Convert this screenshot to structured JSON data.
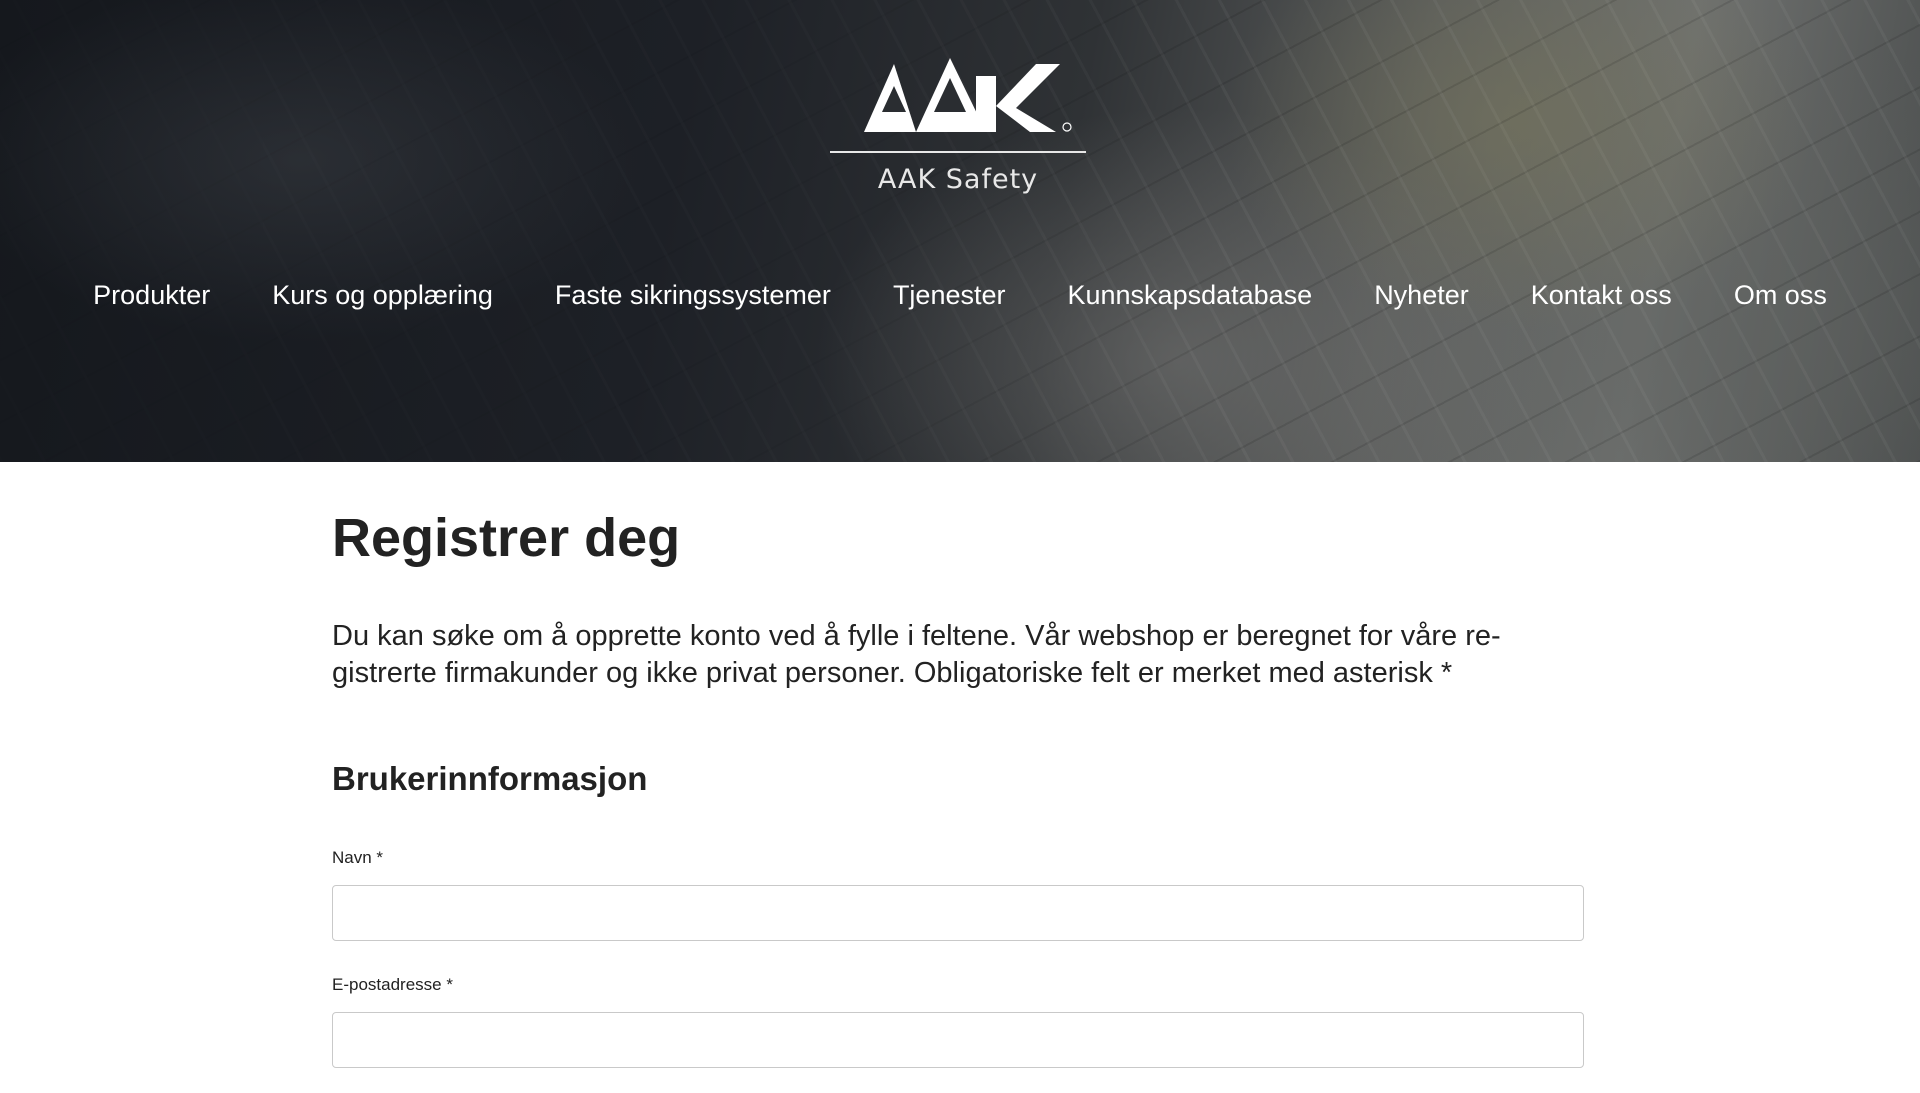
{
  "header": {
    "logo_text": "AAK",
    "brand": "AAK Safety",
    "nav": [
      {
        "label": "Produkter"
      },
      {
        "label": "Kurs og opplæring"
      },
      {
        "label": "Faste sikringssystemer"
      },
      {
        "label": "Tjenester"
      },
      {
        "label": "Kunnskapsdatabase"
      },
      {
        "label": "Nyheter"
      },
      {
        "label": "Kontakt oss"
      },
      {
        "label": "Om oss"
      }
    ]
  },
  "main": {
    "title": "Registrer deg",
    "intro": "Du kan søke om å opprette konto ved å fylle i feltene. Vår webshop er beregnet for våre re­gistrerte firmakunder og ikke privat personer. Obligatoriske felt er merket med asterisk *",
    "section_title": "Brukerinnformasjon",
    "fields": [
      {
        "label": "Navn *",
        "value": ""
      },
      {
        "label": "E-postadresse *",
        "value": ""
      }
    ]
  },
  "colors": {
    "text": "#222222",
    "nav_text": "#ffffff",
    "input_border": "#c9c9c9"
  }
}
